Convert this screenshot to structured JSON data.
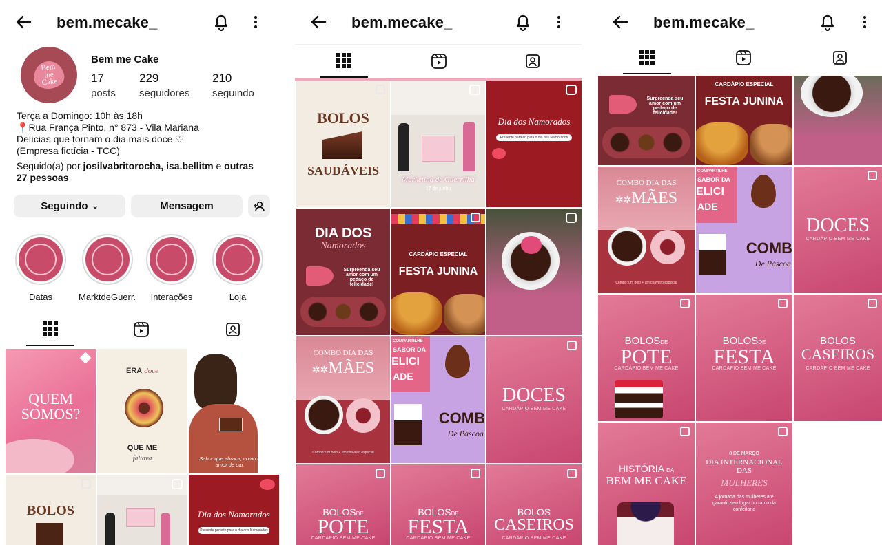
{
  "profile": {
    "username": "bem.mecake_",
    "display_name": "Bem me Cake",
    "avatar_text": "Bem me Cake",
    "posts_count": "17",
    "posts_label": "posts",
    "followers_count": "229",
    "followers_label": "seguidores",
    "following_count": "210",
    "following_label": "seguindo",
    "bio": [
      "Terça a Domingo: 10h às 18h",
      "Rua França Pinto, n° 873 - Vila Mariana",
      "Delícias que tornam o dia mais doce ♡",
      "(Empresa fictícia - TCC)"
    ],
    "followed_by_prefix": "Seguido(a) por ",
    "followed_by_names": "josilvabritorocha, isa.bellitm",
    "followed_by_mid": " e ",
    "followed_by_suffix": "outras",
    "followed_by_count": "27 pessoas"
  },
  "actions": {
    "following_label": "Seguindo",
    "message_label": "Mensagem"
  },
  "highlights": [
    {
      "label": "Datas"
    },
    {
      "label": "MarktdeGuerr..."
    },
    {
      "label": "Interações"
    },
    {
      "label": "Loja"
    }
  ],
  "icons": {
    "back": "arrow-left-icon",
    "bell": "bell-icon",
    "more": "more-vertical-icon",
    "grid": "grid-icon",
    "reels": "reels-icon",
    "tagged": "tagged-icon"
  },
  "colors": {
    "brand_pink": "#c84b6a",
    "dark_red": "#9c1a22",
    "rose": "#e27a97"
  },
  "posts": {
    "quem_somos": "QUEM SOMOS?",
    "era_doce_1": "ERA",
    "era_doce_2": "doce",
    "que_me": "QUE ME",
    "faltava": "faltava",
    "pai_caption": "Sabor que abraça, como o amor de pai.",
    "bolos": "BOLOS",
    "saudaveis": "SAUDÁVEIS",
    "marketing": "Marketing de Guerrilha",
    "date_small": "17 de junho",
    "namorados": "Dia dos Namorados",
    "namorados_sub": "Presente perfeito para o dia dos Namorados",
    "dia_dos": "DIA DOS",
    "namorados_script": "Namorados",
    "surpreenda": "Surpreenda seu amor com um pedaço de felicidade!",
    "cardapio_especial": "CARDÁPIO ESPECIAL",
    "festa_junina": "FESTA JUNINA",
    "combo_dia_das": "COMBO DIA DAS",
    "maes": "MÃES",
    "combo_caption": "Combo: um bolo + um chaveiro especial",
    "compartilhe": "COMPARTILHE",
    "sabor_da": "SABOR DA",
    "elici": "ELICI",
    "ade": "ADE",
    "comb": "COMB",
    "de_pascoa": "De Páscoa",
    "doces": "DOCES",
    "cardapio": "CARDÁPIO BEM ME CAKE",
    "bolos_small": "BOLOS",
    "de": "DE",
    "pote": "POTE",
    "festa": "FESTA",
    "caseiros": "CASEIROS",
    "historia": "HISTÓRIA",
    "da": "DA",
    "bem_me_cake": "BEM ME CAKE",
    "marco": "8 DE MARÇO",
    "dia_internacional": "DIA INTERNACIONAL DAS",
    "mulheres": "MULHERES",
    "jornada": "A jornada das mulheres até garantir seu lugar no ramo da confeitaria"
  }
}
